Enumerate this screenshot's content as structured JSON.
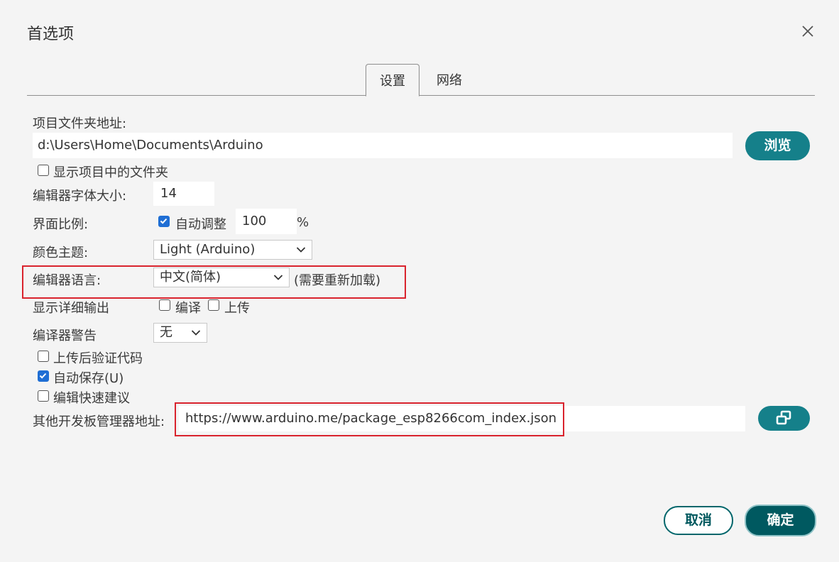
{
  "dialog": {
    "title": "首选项"
  },
  "tabs": [
    {
      "label": "设置"
    },
    {
      "label": "网络"
    }
  ],
  "settings": {
    "sketchbook_label": "项目文件夹地址:",
    "sketchbook_path": "d:\\Users\\Home\\Documents\\Arduino",
    "browse_label": "浏览",
    "show_files_label": "显示项目中的文件夹",
    "font_size_label": "编辑器字体大小:",
    "font_size_value": "14",
    "scale_label": "界面比例:",
    "auto_adjust_label": "自动调整",
    "scale_value": "100",
    "scale_unit": "%",
    "theme_label": "颜色主题:",
    "theme_value": "Light (Arduino)",
    "language_label": "编辑器语言:",
    "language_value": "中文(简体)",
    "language_note": "(需要重新加载)",
    "verbose_label": "显示详细输出",
    "verbose_compile_label": "编译",
    "verbose_upload_label": "上传",
    "warnings_label": "编译器警告",
    "warnings_value": "无",
    "verify_label": "上传后验证代码",
    "autosave_label": "自动保存(U)",
    "quick_suggest_label": "编辑快速建议",
    "board_urls_label": "其他开发板管理器地址:",
    "board_urls_value": "https://www.arduino.me/package_esp8266com_index.json"
  },
  "state": {
    "auto_adjust": true,
    "autosave": true,
    "show_files": false,
    "verbose_compile": false,
    "verbose_upload": false,
    "verify_after_upload": false,
    "quick_suggestions": false
  },
  "footer": {
    "cancel_label": "取消",
    "ok_label": "确定"
  },
  "colors": {
    "accent": "#15808a",
    "accent_dark": "#005960",
    "highlight": "#d9232d",
    "checkbox_on": "#1f6ed4"
  }
}
